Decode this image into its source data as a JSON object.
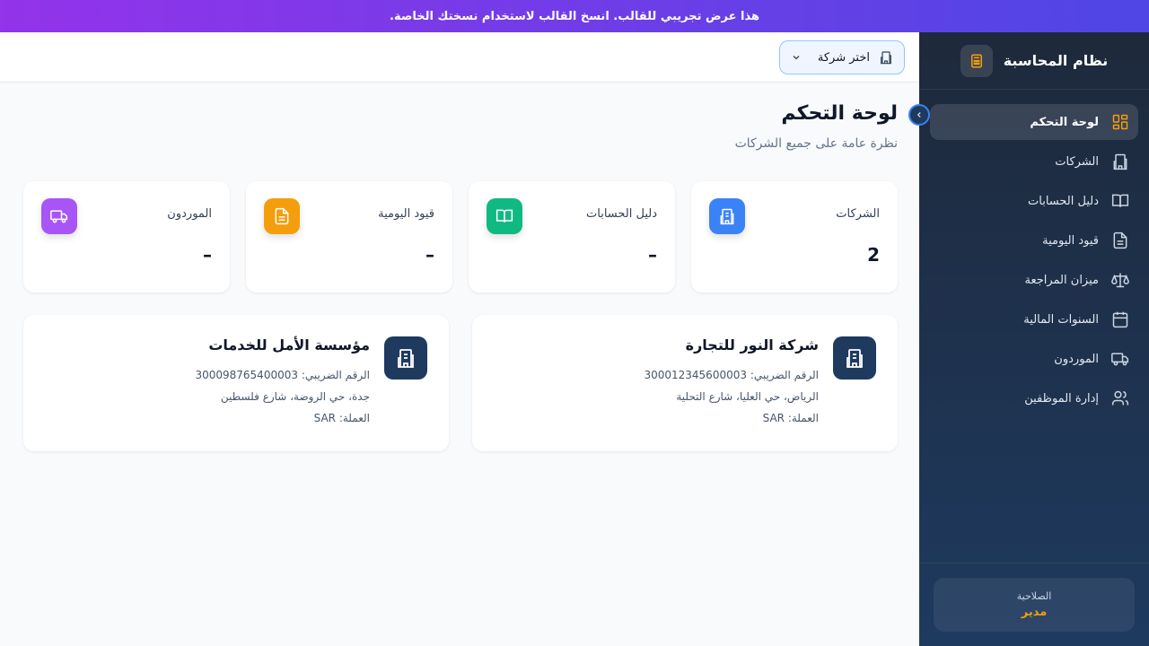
{
  "banner": {
    "text": "هذا عرض تجريبي للقالب. انسخ القالب لاستخدام نسختك الخاصة."
  },
  "sidebar": {
    "brand": "نظام المحاسبة",
    "items": [
      {
        "label": "لوحة التحكم",
        "icon": "dashboard-icon",
        "active": true
      },
      {
        "label": "الشركات",
        "icon": "building-icon"
      },
      {
        "label": "دليل الحسابات",
        "icon": "book-icon"
      },
      {
        "label": "قيود اليومية",
        "icon": "document-icon"
      },
      {
        "label": "ميزان المراجعة",
        "icon": "scale-icon"
      },
      {
        "label": "السنوات المالية",
        "icon": "calendar-icon"
      },
      {
        "label": "الموردون",
        "icon": "truck-icon"
      },
      {
        "label": "إدارة الموظفين",
        "icon": "users-icon"
      }
    ],
    "role": {
      "label": "الصلاحية",
      "value": "مدير"
    }
  },
  "header": {
    "company_select": "اختر شركة"
  },
  "page": {
    "title": "لوحة التحكم",
    "subtitle": "نظرة عامة على جميع الشركات"
  },
  "stats": [
    {
      "label": "الشركات",
      "value": "2",
      "icon": "building-icon",
      "color": "#3b82f6"
    },
    {
      "label": "دليل الحسابات",
      "value": "–",
      "icon": "book-icon",
      "color": "#10b981"
    },
    {
      "label": "قيود اليومية",
      "value": "–",
      "icon": "document-icon",
      "color": "#f59e0b"
    },
    {
      "label": "الموردون",
      "value": "–",
      "icon": "truck-icon",
      "color": "#a855f7"
    }
  ],
  "companies": [
    {
      "name": "شركة النور للتجارة",
      "tax": "الرقم الضريبي: 300012345600003",
      "address": "الرياض، حي العليا، شارع التحلية",
      "currency": "العملة: SAR"
    },
    {
      "name": "مؤسسة الأمل للخدمات",
      "tax": "الرقم الضريبي: 300098765400003",
      "address": "جدة، حي الروضة، شارع فلسطين",
      "currency": "العملة: SAR"
    }
  ],
  "colors": {
    "accent": "#f59e0b",
    "sidebar_bg": "#1e293b",
    "banner_from": "#9333ea",
    "banner_to": "#4f46e5"
  }
}
